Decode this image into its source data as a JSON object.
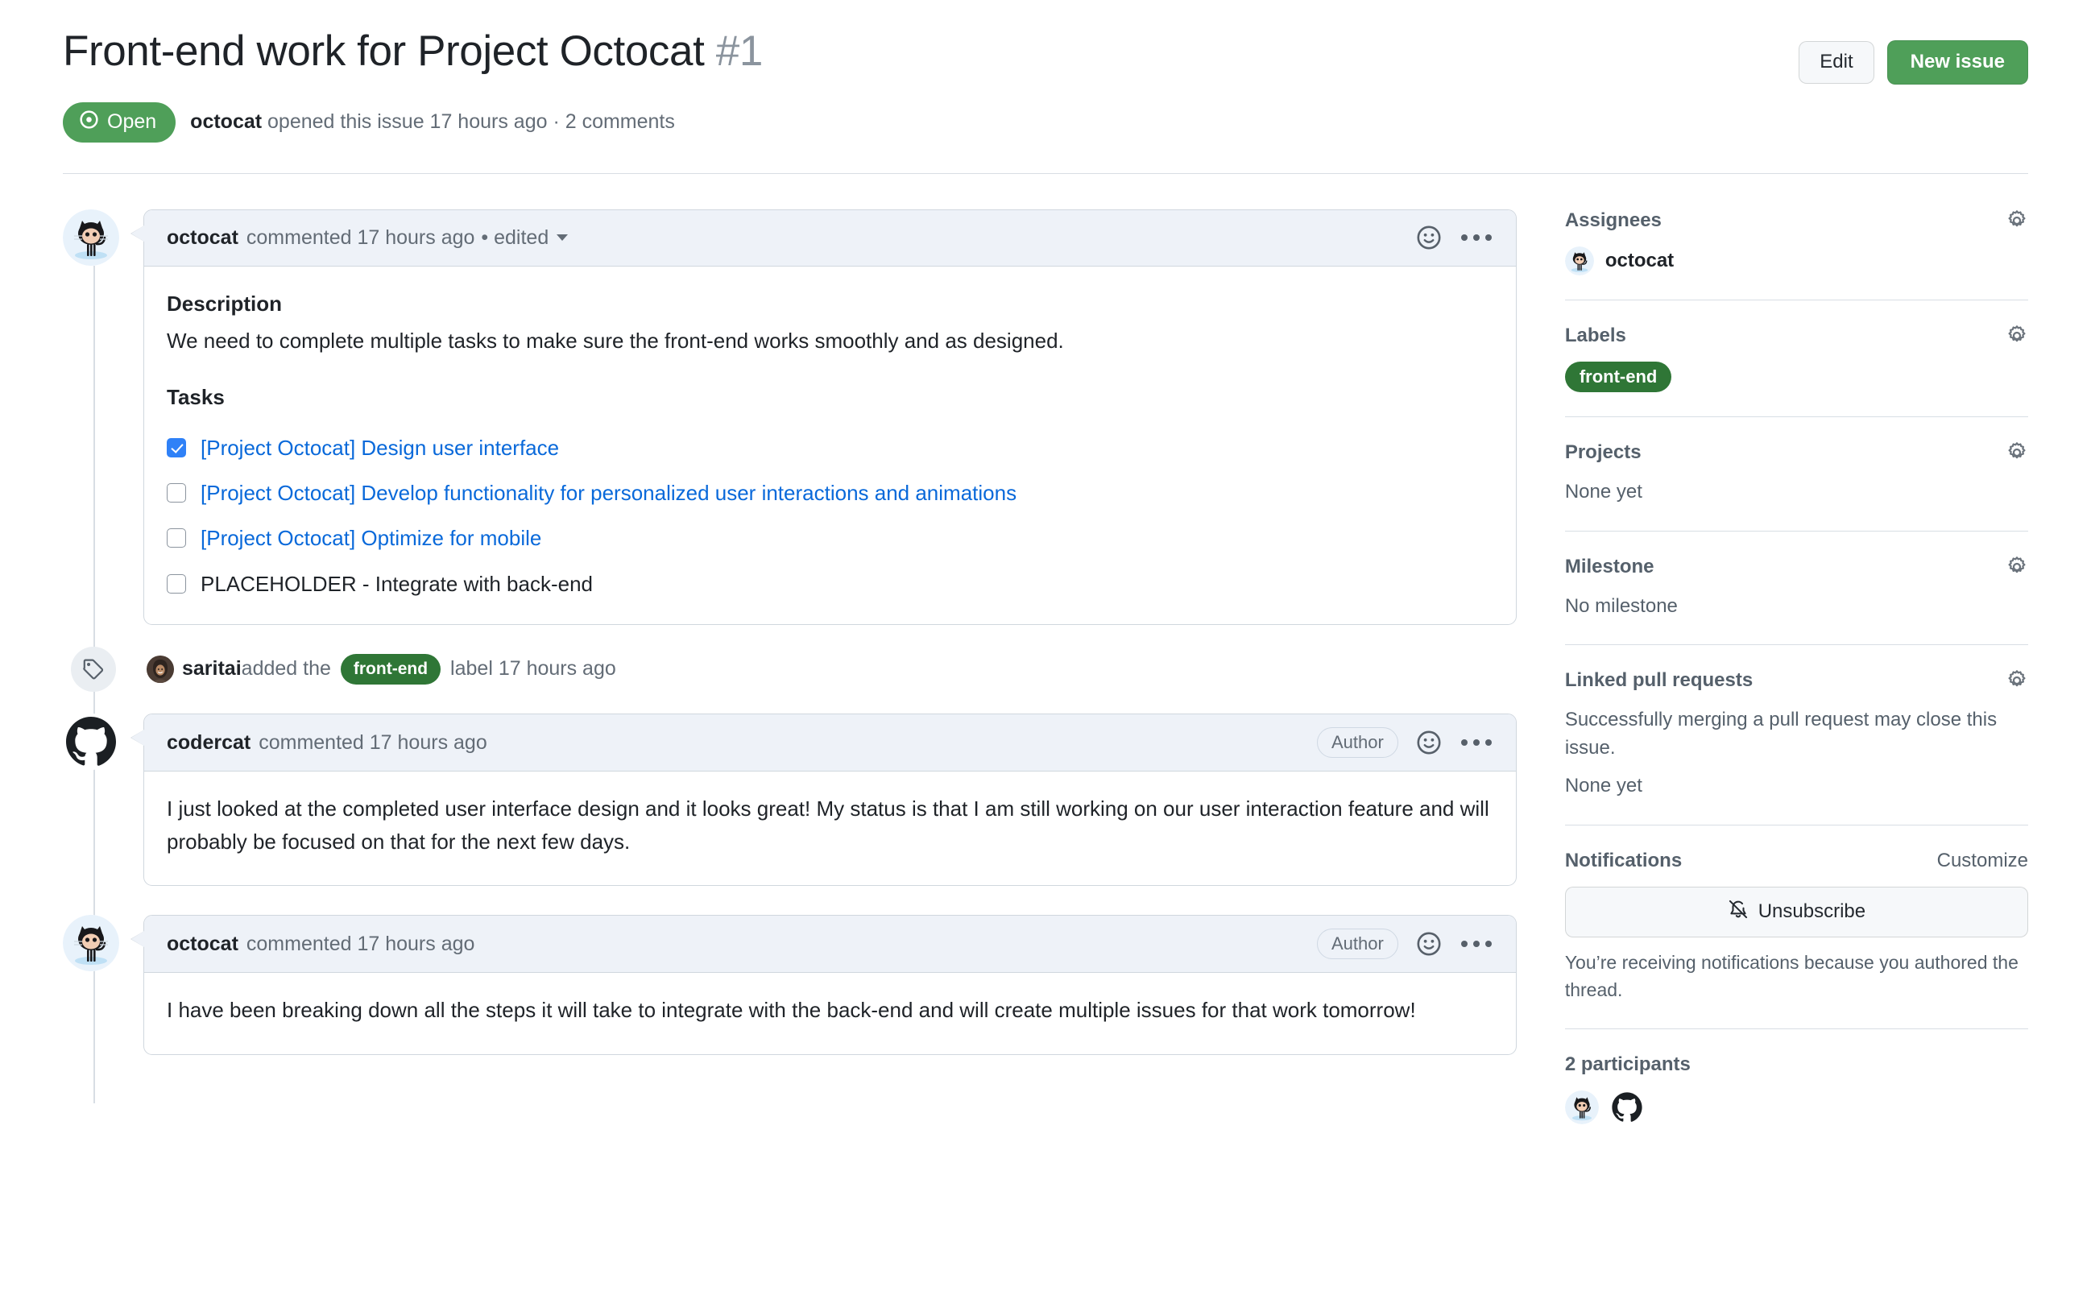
{
  "header": {
    "title": "Front-end work for Project Octocat",
    "number": "#1",
    "edit_label": "Edit",
    "new_issue_label": "New issue",
    "state": "Open",
    "meta_author": "octocat",
    "meta_text": " opened this issue 17 hours ago · 2 comments"
  },
  "colors": {
    "open_green": "#4f9f59",
    "label_green": "#2f7636",
    "link_blue": "#0969da",
    "checkbox_blue": "#2f81f7"
  },
  "timeline": {
    "first_comment": {
      "author": "octocat",
      "meta": "commented 17 hours ago",
      "edited": "• edited",
      "description_heading": "Description",
      "description_text": "We need to complete multiple tasks to make sure the front-end works smoothly and as designed.",
      "tasks_heading": "Tasks",
      "tasks": [
        {
          "checked": true,
          "text": "[Project Octocat] Design user interface",
          "link": true
        },
        {
          "checked": false,
          "text": "[Project Octocat] Develop functionality for personalized user interactions and animations",
          "link": true
        },
        {
          "checked": false,
          "text": "[Project Octocat] Optimize for mobile",
          "link": true
        },
        {
          "checked": false,
          "text": "PLACEHOLDER - Integrate with back-end",
          "link": false
        }
      ]
    },
    "label_event": {
      "actor": "saritai",
      "pre_text": " added the ",
      "label": "front-end",
      "post_text": " label 17 hours ago"
    },
    "second_comment": {
      "author": "codercat",
      "meta": "commented 17 hours ago",
      "badge": "Author",
      "body": "I just looked at the completed user interface design and it looks great! My status is that I am still working on our user interaction feature and will probably be focused on that for the next few days."
    },
    "third_comment": {
      "author": "octocat",
      "meta": "commented 17 hours ago",
      "badge": "Author",
      "body": "I have been breaking down all the steps it will take to integrate with the back-end and will create multiple issues for that work tomorrow!"
    }
  },
  "sidebar": {
    "assignees": {
      "title": "Assignees",
      "name": "octocat"
    },
    "labels": {
      "title": "Labels",
      "label": "front-end"
    },
    "projects": {
      "title": "Projects",
      "value": "None yet"
    },
    "milestone": {
      "title": "Milestone",
      "value": "No milestone"
    },
    "linked_prs": {
      "title": "Linked pull requests",
      "help": "Successfully merging a pull request may close this issue.",
      "value": "None yet"
    },
    "notifications": {
      "title": "Notifications",
      "customize": "Customize",
      "button": "Unsubscribe",
      "note": "You’re receiving notifications because you authored the thread."
    },
    "participants": {
      "title": "2 participants"
    }
  }
}
